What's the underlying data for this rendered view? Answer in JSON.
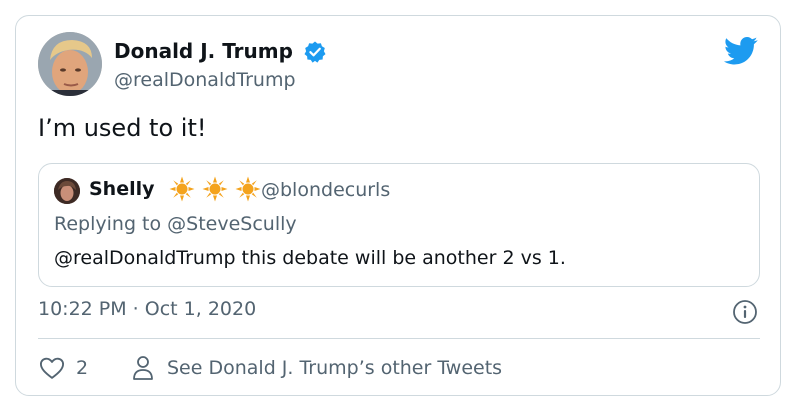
{
  "tweet": {
    "author": {
      "name": "Donald J. Trump",
      "handle": "@realDonaldTrump",
      "verified": true,
      "avatar_icon": "avatar-photo"
    },
    "text": "I’m used to it!",
    "timestamp": "10:22 PM · Oct 1, 2020",
    "platform_icon": "twitter-bird-icon"
  },
  "quoted_tweet": {
    "name": "Shelly",
    "emoji": [
      "sun",
      "sun",
      "sun"
    ],
    "handle": "@blondecurls",
    "replying_prefix": "Replying to ",
    "replying_to": "@SteveScully",
    "text": "@realDonaldTrump this debate will be another 2 vs 1."
  },
  "actions": {
    "like_count": "2",
    "see_other_label": "See Donald J. Trump’s other Tweets"
  },
  "colors": {
    "text_primary": "#0f1419",
    "text_secondary": "#536471",
    "accent_blue": "#1d9bf0",
    "border": "#cfd9de",
    "sun_yellow": "#f4a31d"
  }
}
